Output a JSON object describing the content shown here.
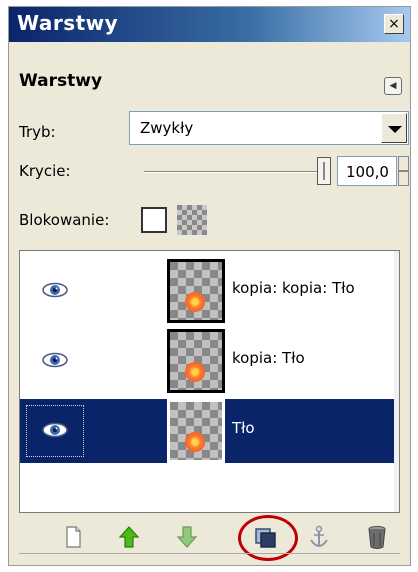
{
  "window": {
    "title": "Warstwy"
  },
  "panel": {
    "section_title": "Warstwy",
    "mode_label": "Tryb:",
    "mode_value": "Zwykły",
    "opacity_label": "Krycie:",
    "opacity_value": "100,0",
    "opacity_level_pct": 100,
    "lock_label": "Blokowanie:"
  },
  "layers": [
    {
      "name": "kopia: kopia: Tło",
      "visible": true,
      "selected": false
    },
    {
      "name": "kopia: Tło",
      "visible": true,
      "selected": false
    },
    {
      "name": "Tło",
      "visible": true,
      "selected": true
    }
  ],
  "toolbar": {
    "buttons": [
      "new-layer-icon",
      "raise-layer-icon",
      "lower-layer-icon",
      "duplicate-layer-icon",
      "anchor-layer-icon",
      "delete-layer-icon"
    ],
    "highlighted": "duplicate-layer-icon"
  },
  "colors": {
    "selection": "#0a246a",
    "highlight_ring": "#c00000"
  }
}
